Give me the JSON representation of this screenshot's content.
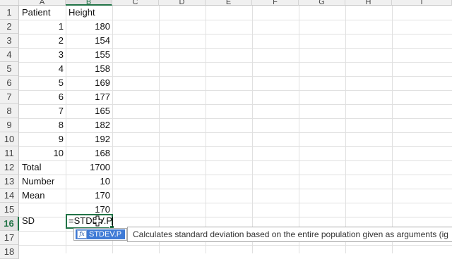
{
  "columns": [
    "A",
    "B",
    "C",
    "D",
    "E",
    "F",
    "G",
    "H",
    "I"
  ],
  "selected_column": "B",
  "rows": [
    "1",
    "2",
    "3",
    "4",
    "5",
    "6",
    "7",
    "8",
    "9",
    "10",
    "11",
    "12",
    "13",
    "14",
    "15",
    "16",
    "17",
    "18"
  ],
  "selected_row": "16",
  "cells": {
    "A1": "Patient",
    "B1": "Height",
    "A2": "1",
    "B2": "180",
    "A3": "2",
    "B3": "154",
    "A4": "3",
    "B4": "155",
    "A5": "4",
    "B5": "158",
    "A6": "5",
    "B6": "169",
    "A7": "6",
    "B7": "177",
    "A8": "7",
    "B8": "165",
    "A9": "8",
    "B9": "182",
    "A10": "9",
    "B10": "192",
    "A11": "10",
    "B11": "168",
    "A12": "Total",
    "B12": "1700",
    "A13": "Number",
    "B13": "10",
    "A14": "Mean",
    "B14": "170",
    "B15": "170",
    "A16": "SD"
  },
  "editing_cell": {
    "ref": "B16",
    "text": "=STDEV.P"
  },
  "autocomplete": {
    "items": [
      {
        "icon": "function-icon",
        "label": "STDEV.P",
        "selected": true
      }
    ]
  },
  "tooltip": {
    "text": "Calculates standard deviation based on the entire population given as arguments (ig"
  },
  "colors": {
    "accent": "#217346",
    "autocomplete_highlight": "#3e7ad6"
  }
}
